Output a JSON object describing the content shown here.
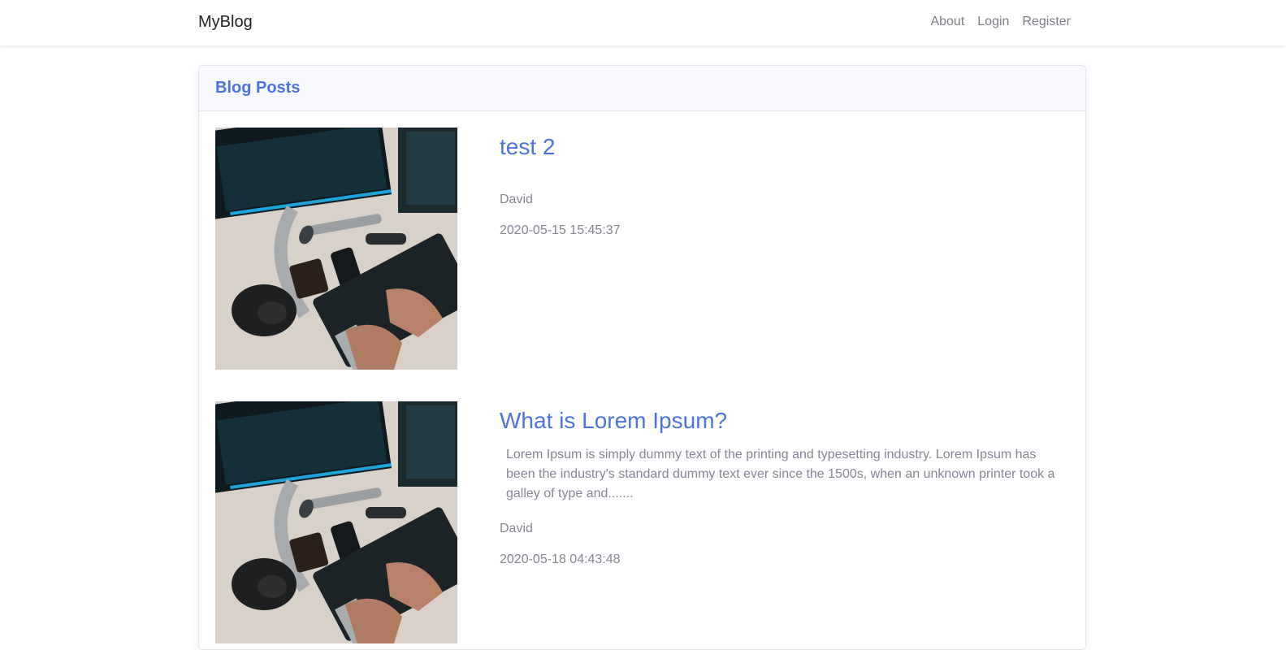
{
  "navbar": {
    "brand": "MyBlog",
    "links": [
      "About",
      "Login",
      "Register"
    ]
  },
  "card": {
    "title": "Blog Posts"
  },
  "posts": [
    {
      "title": "test 2",
      "excerpt": "",
      "author": "David",
      "date": "2020-05-15 15:45:37"
    },
    {
      "title": "What is Lorem Ipsum?",
      "excerpt": "Lorem Ipsum is simply dummy text of the printing and typesetting industry. Lorem Ipsum has been the industry's standard dummy text ever since the 1500s, when an unknown printer took a galley of type and.......",
      "author": "David",
      "date": "2020-05-18 04:43:48"
    }
  ],
  "colors": {
    "accent": "#4e73df",
    "muted_text": "#858796",
    "nav_link": "#7b7f86"
  }
}
